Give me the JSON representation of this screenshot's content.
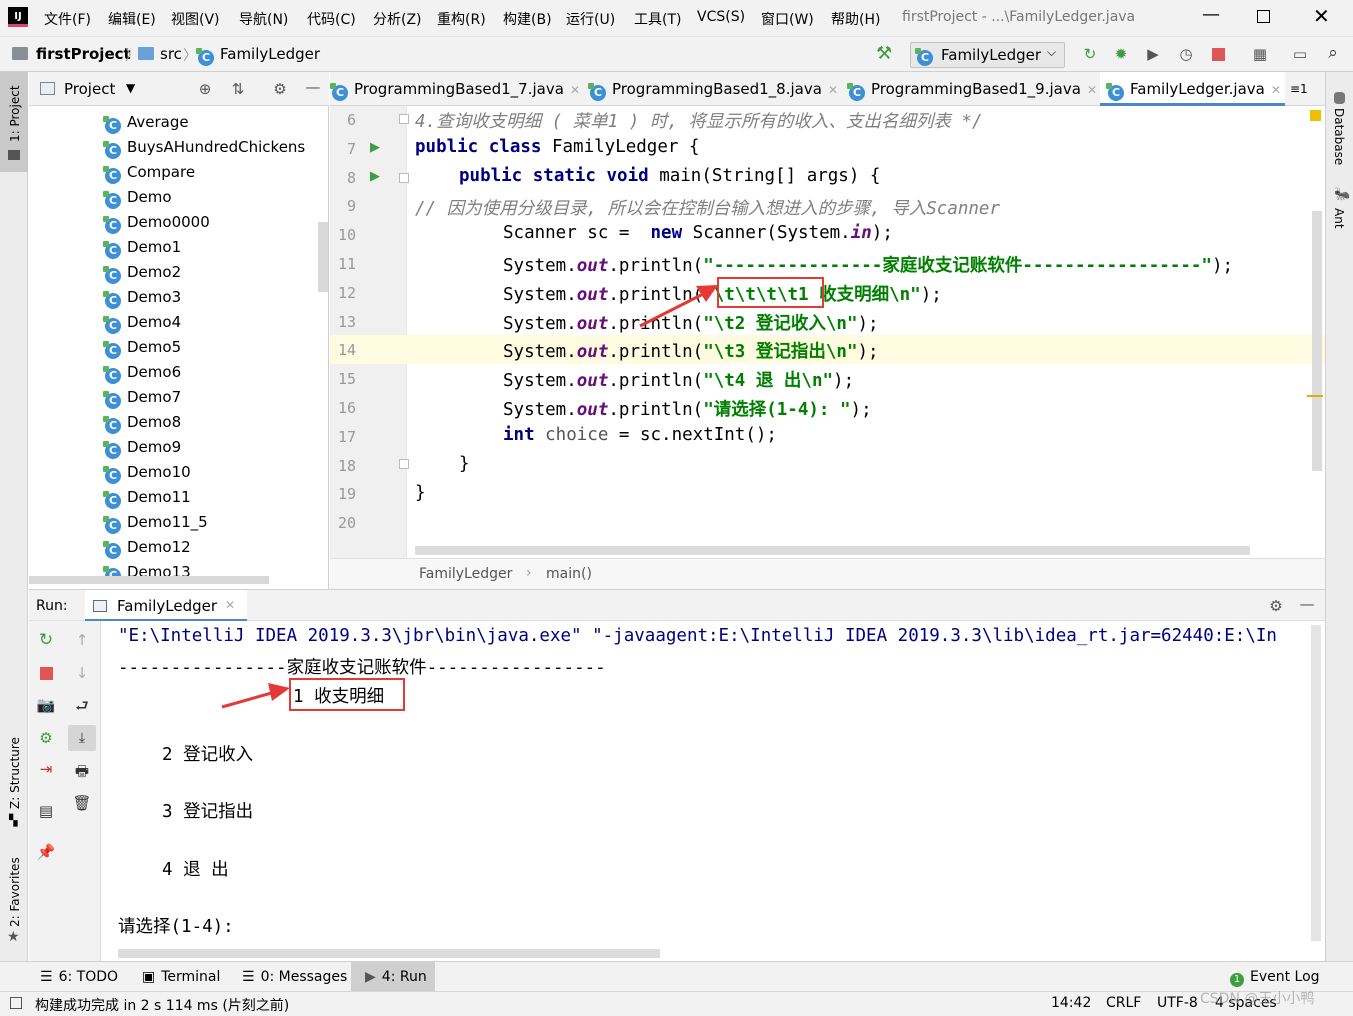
{
  "menu": {
    "items": [
      "文件(F)",
      "编辑(E)",
      "视图(V)",
      "导航(N)",
      "代码(C)",
      "分析(Z)",
      "重构(R)",
      "构建(B)",
      "运行(U)",
      "工具(T)",
      "VCS(S)",
      "窗口(W)",
      "帮助(H)"
    ],
    "window_title": "firstProject - ...\\FamilyLedger.java"
  },
  "nav": {
    "project": "firstProject",
    "src": "src",
    "file": "FamilyLedger",
    "run_config": "FamilyLedger"
  },
  "left_strip": {
    "project": "1: Project",
    "structure": "Z: Structure",
    "favorites": "2: Favorites"
  },
  "right_strip": {
    "database": "Database",
    "ant": "Ant"
  },
  "project_panel": {
    "title": "Project",
    "items": [
      "Average",
      "BuysAHundredChickens",
      "Compare",
      "Demo",
      "Demo0000",
      "Demo1",
      "Demo2",
      "Demo3",
      "Demo4",
      "Demo5",
      "Demo6",
      "Demo7",
      "Demo8",
      "Demo9",
      "Demo10",
      "Demo11",
      "Demo11_5",
      "Demo12",
      "Demo13"
    ]
  },
  "tabs": [
    {
      "label": "ProgrammingBased1_7.java"
    },
    {
      "label": "ProgrammingBased1_8.java"
    },
    {
      "label": "ProgrammingBased1_9.java"
    },
    {
      "label": "FamilyLedger.java"
    }
  ],
  "tab_overflow": "≡1",
  "editor": {
    "line_numbers": [
      "6",
      "7",
      "8",
      "9",
      "10",
      "11",
      "12",
      "13",
      "14",
      "15",
      "16",
      "17",
      "18",
      "19",
      "20"
    ],
    "line6": "4.查询收支明细 ( 菜单1 ) 时, 将显示所有的收入、支出名细列表 */",
    "line7_kw": "public class",
    "line7_rest": " FamilyLedger {",
    "line8_kw": "public static void",
    "line8_rest": " main(String[] args) {",
    "line9": "// 因为使用分级目录, 所以会在控制台输入想进入的步骤, 导入Scanner",
    "line10_a": "Scanner sc =  ",
    "line10_kw": "new",
    "line10_b": " Scanner(System.",
    "line10_fld": "in",
    "line10_c": ");",
    "sys": "System.",
    "out": "out",
    "println": ".println(",
    "line11_str": "\"----------------家庭收支记账软件-----------------\"",
    "line12_str1": "\"\\t\\t\\t\\t1",
    "line12_str2": " 收支明细\\n\"",
    "line13_str": "\"\\t2 登记收入\\n\"",
    "line14_str": "\"\\t3 登记指出\\n\"",
    "line15_str": "\"\\t4 退 出\\n\"",
    "line16_str": "\"请选择(1-4): \"",
    "end_paren": ");",
    "line17_kw": "int",
    "line17_var": " choice",
    "line17_rest": " = sc.nextInt();",
    "close_brace": "}"
  },
  "breadcrumb": {
    "cls": "FamilyLedger",
    "method": "main()"
  },
  "run": {
    "label": "Run:",
    "tab": "FamilyLedger",
    "cmd": "\"E:\\IntelliJ IDEA 2019.3.3\\jbr\\bin\\java.exe\" \"-javaagent:E:\\IntelliJ IDEA 2019.3.3\\lib\\idea_rt.jar=62440:E:\\In",
    "out1": "----------------家庭收支记账软件-----------------",
    "out2": "1 收支明细",
    "out3": "2 登记收入",
    "out4": "3 登记指出",
    "out5": "4 退 出",
    "out6": "请选择(1-4):"
  },
  "bottom_tabs": [
    "6: TODO",
    "Terminal",
    "0: Messages",
    "4: Run"
  ],
  "event_log": "Event Log",
  "status": {
    "message": "构建成功完成 in 2 s 114 ms (片刻之前)",
    "position": "14:42",
    "line_sep": "CRLF",
    "encoding": "UTF-8",
    "indent": "4 spaces",
    "watermark": "CSDN @王小小鸭"
  },
  "colors": {
    "accent_red": "#e53935",
    "keyword": "#000080",
    "string": "#008000",
    "run_green": "#3c9e3c"
  }
}
